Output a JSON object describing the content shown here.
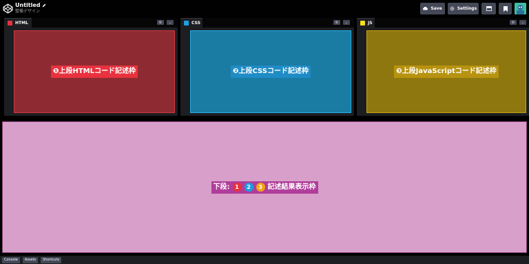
{
  "header": {
    "title": "Untitled",
    "subtitle": "整備デザイン",
    "buttons": {
      "save": "Save",
      "settings": "Settings"
    }
  },
  "editors": [
    {
      "tab": "HTML",
      "label": "❶上段HTMLコード記述枠",
      "icon_color": "#e44d26",
      "box_color": "#8e2b32",
      "box_border": "#d2363e",
      "label_bg": "#e8323e"
    },
    {
      "tab": "CSS",
      "label": "❷上段CSSコード記述枠",
      "icon_color": "#1ba1e2",
      "box_color": "#1a7ba3",
      "box_border": "#27b0e6",
      "label_bg": "#1f8cc6"
    },
    {
      "tab": "JS",
      "label": "❸上段JavaScriptコード記述枠",
      "icon_color": "#f7df1e",
      "box_color": "#8e770f",
      "box_border": "#c9a50f",
      "label_bg": "#b8930f"
    }
  ],
  "result": {
    "prefix": "下段:",
    "nums": [
      "1",
      "2",
      "3"
    ],
    "num_colors": [
      "#e8323e",
      "#1f9ce0",
      "#f2a615"
    ],
    "suffix": "記述結果表示枠"
  },
  "footer": {
    "console": "Console",
    "assets": "Assets",
    "shortcuts": "Shortcuts"
  }
}
